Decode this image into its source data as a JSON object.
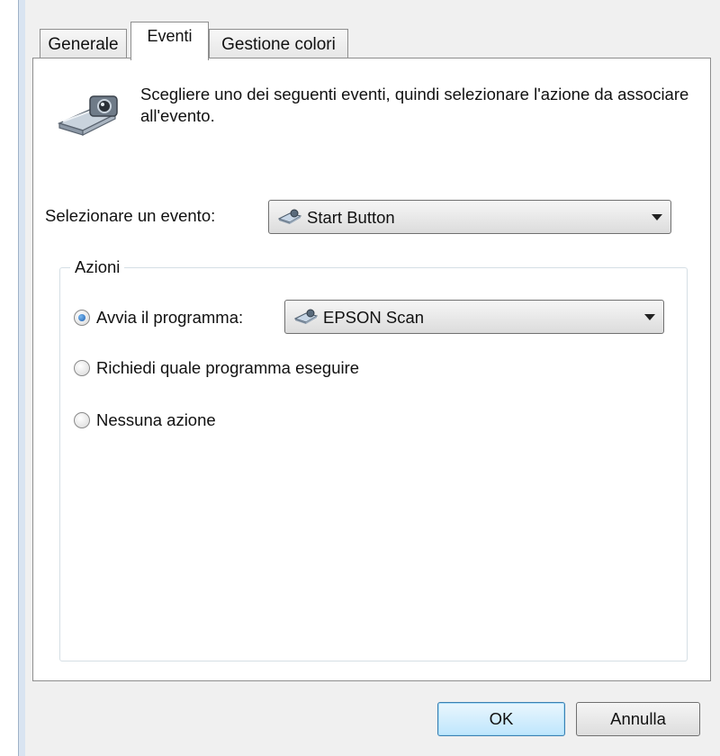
{
  "tabs": [
    {
      "label": "Generale",
      "active": false
    },
    {
      "label": "Eventi",
      "active": true
    },
    {
      "label": "Gestione colori",
      "active": false
    }
  ],
  "intro": {
    "text": "Scegliere uno dei seguenti eventi, quindi selezionare l'azione da associare all'evento.",
    "icon": "scanner-camera-icon"
  },
  "event_select": {
    "label": "Selezionare un evento:",
    "value": "Start Button",
    "icon": "scanner-icon"
  },
  "actions": {
    "legend": "Azioni",
    "options": [
      {
        "label": "Avvia il programma:",
        "checked": true
      },
      {
        "label": "Richiedi quale programma eseguire",
        "checked": false
      },
      {
        "label": "Nessuna azione",
        "checked": false
      }
    ],
    "program_select": {
      "value": "EPSON Scan",
      "icon": "scanner-icon"
    }
  },
  "buttons": {
    "ok": "OK",
    "cancel": "Annulla"
  },
  "colors": {
    "accent": "#3c7fb1",
    "radio_dot": "#1d5fb0",
    "window_bg": "#f0f0f0"
  }
}
